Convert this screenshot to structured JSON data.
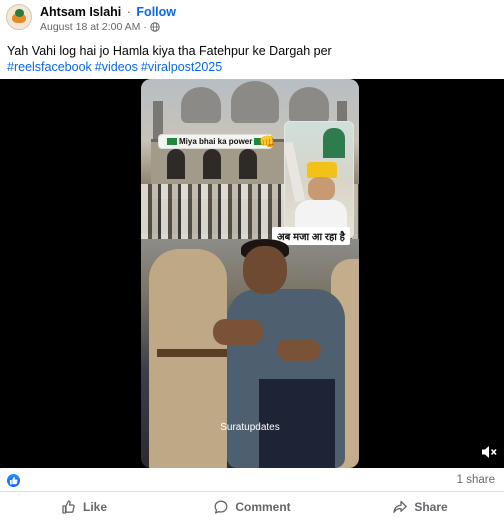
{
  "post": {
    "author": "Ahtsam Islahi",
    "separator": "·",
    "follow_label": "Follow",
    "timestamp": "August 18 at 2:00 AM",
    "meta_separator": "·",
    "audience_icon": "globe-icon",
    "caption": "Yah Vahi log hai jo Hamla kiya tha Fatehpur ke Dargah per",
    "hashtags": [
      "#reelsfacebook",
      "#videos",
      "#viralpost2025"
    ]
  },
  "video": {
    "sticker_text": "Miya bhai ka power",
    "sticker_emoji": "👊",
    "hindi_overlay": "अब मजा आ रहा है",
    "watermark": "Suratupdates",
    "volume_icon": "speaker-muted-icon"
  },
  "stats": {
    "reaction_icon": "like-reaction-icon",
    "shares": "1 share"
  },
  "actions": [
    {
      "label": "Like",
      "icon": "thumbs-up-icon"
    },
    {
      "label": "Comment",
      "icon": "comment-icon"
    },
    {
      "label": "Share",
      "icon": "share-arrow-icon"
    }
  ],
  "colors": {
    "brand_blue": "#0866ff",
    "secondary_text": "#65676b",
    "divider": "#dadde1"
  }
}
